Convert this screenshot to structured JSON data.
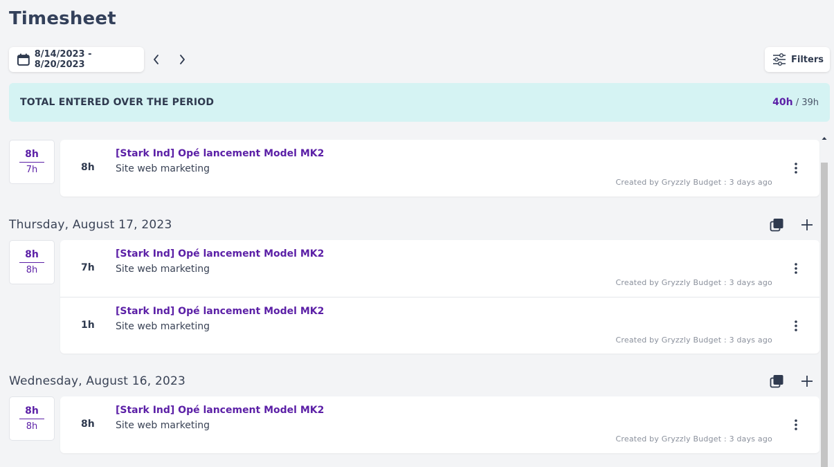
{
  "page": {
    "title": "Timesheet"
  },
  "toolbar": {
    "date_range": "8/14/2023 - 8/20/2023",
    "filters_label": "Filters"
  },
  "total": {
    "label": "TOTAL ENTERED OVER THE PERIOD",
    "entered": "40h",
    "separator": " / ",
    "expected": "39h"
  },
  "days": [
    {
      "header": "",
      "entered": "8h",
      "expected": "7h",
      "entries": [
        {
          "hours": "8h",
          "project": "[Stark Ind] Opé lancement Model MK2",
          "task": "Site web marketing",
          "created": "Created by Gryzzly Budget : 3 days ago"
        }
      ]
    },
    {
      "header": "Thursday, August 17, 2023",
      "entered": "8h",
      "expected": "8h",
      "entries": [
        {
          "hours": "7h",
          "project": "[Stark Ind] Opé lancement Model MK2",
          "task": "Site web marketing",
          "created": "Created by Gryzzly Budget : 3 days ago"
        },
        {
          "hours": "1h",
          "project": "[Stark Ind] Opé lancement Model MK2",
          "task": "Site web marketing",
          "created": "Created by Gryzzly Budget : 3 days ago"
        }
      ]
    },
    {
      "header": "Wednesday, August 16, 2023",
      "entered": "8h",
      "expected": "8h",
      "entries": [
        {
          "hours": "8h",
          "project": "[Stark Ind] Opé lancement Model MK2",
          "task": "Site web marketing",
          "created": "Created by Gryzzly Budget : 3 days ago"
        }
      ]
    }
  ],
  "colors": {
    "accent": "#5b1fa6",
    "banner_bg": "#d5f3f3",
    "page_bg": "#f3f4f6"
  },
  "icons": [
    "calendar-icon",
    "chevron-left-icon",
    "chevron-right-icon",
    "filter-sliders-icon",
    "copy-icon",
    "plus-icon",
    "kebab-menu-icon"
  ]
}
